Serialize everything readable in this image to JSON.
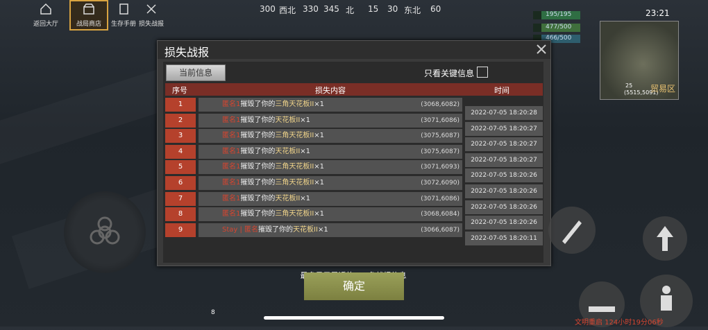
{
  "hud": {
    "buttons": [
      {
        "label": "返回大厅",
        "icon": "home-icon"
      },
      {
        "label": "战局商店",
        "icon": "shop-icon"
      },
      {
        "label": "生存手册",
        "icon": "book-icon"
      },
      {
        "label": "损失战报",
        "icon": "battle-report-icon"
      }
    ],
    "compass": [
      "300",
      "西北",
      "330",
      "345",
      "北",
      "15",
      "30",
      "东北",
      "60"
    ],
    "stats": [
      "195/195",
      "477/500",
      "466/500"
    ],
    "clock": "23:21",
    "minimap_label": "贸易区",
    "minimap_coords_top": "25",
    "minimap_coords": "(5515,5091)"
  },
  "dialog": {
    "title": "损失战报",
    "tab_current": "当前信息",
    "filter_label": "只看关键信息",
    "headers": {
      "no": "序号",
      "content": "损失内容",
      "time": "时间"
    },
    "rows": [
      {
        "no": "1",
        "attacker": "匿名1",
        "verb": "摧毁了你的",
        "item": "三角天花板II",
        "qty": "×1",
        "coord": "(3068,6082)",
        "time": "2022-07-05 18:20:28"
      },
      {
        "no": "2",
        "attacker": "匿名1",
        "verb": "摧毁了你的",
        "item": "天花板II",
        "qty": "×1",
        "coord": "(3071,6086)",
        "time": "2022-07-05 18:20:27"
      },
      {
        "no": "3",
        "attacker": "匿名1",
        "verb": "摧毁了你的",
        "item": "三角天花板II",
        "qty": "×1",
        "coord": "(3075,6087)",
        "time": "2022-07-05 18:20:27"
      },
      {
        "no": "4",
        "attacker": "匿名1",
        "verb": "摧毁了你的",
        "item": "天花板II",
        "qty": "×1",
        "coord": "(3075,6087)",
        "time": "2022-07-05 18:20:27"
      },
      {
        "no": "5",
        "attacker": "匿名1",
        "verb": "摧毁了你的",
        "item": "三角天花板II",
        "qty": "×1",
        "coord": "(3071,6093)",
        "time": "2022-07-05 18:20:26"
      },
      {
        "no": "6",
        "attacker": "匿名1",
        "verb": "摧毁了你的",
        "item": "三角天花板II",
        "qty": "×1",
        "coord": "(3072,6090)",
        "time": "2022-07-05 18:20:26"
      },
      {
        "no": "7",
        "attacker": "匿名1",
        "verb": "摧毁了你的",
        "item": "天花板II",
        "qty": "×1",
        "coord": "(3071,6086)",
        "time": "2022-07-05 18:20:26"
      },
      {
        "no": "8",
        "attacker": "匿名1",
        "verb": "摧毁了你的",
        "item": "三角天花板II",
        "qty": "×1",
        "coord": "(3068,6084)",
        "time": "2022-07-05 18:20:26"
      },
      {
        "no": "9",
        "attacker": "Stay | 匿名",
        "verb": "摧毁了你的",
        "item": "天花板II",
        "qty": "×1",
        "coord": "(3066,6087)",
        "time": "2022-07-05 18:20:11"
      }
    ],
    "footer": "最多显示最近的200条战报信息",
    "ok": "确定"
  },
  "bottom": {
    "status": "文明重启 124小时19分06秒",
    "hotbar_count": "8"
  }
}
